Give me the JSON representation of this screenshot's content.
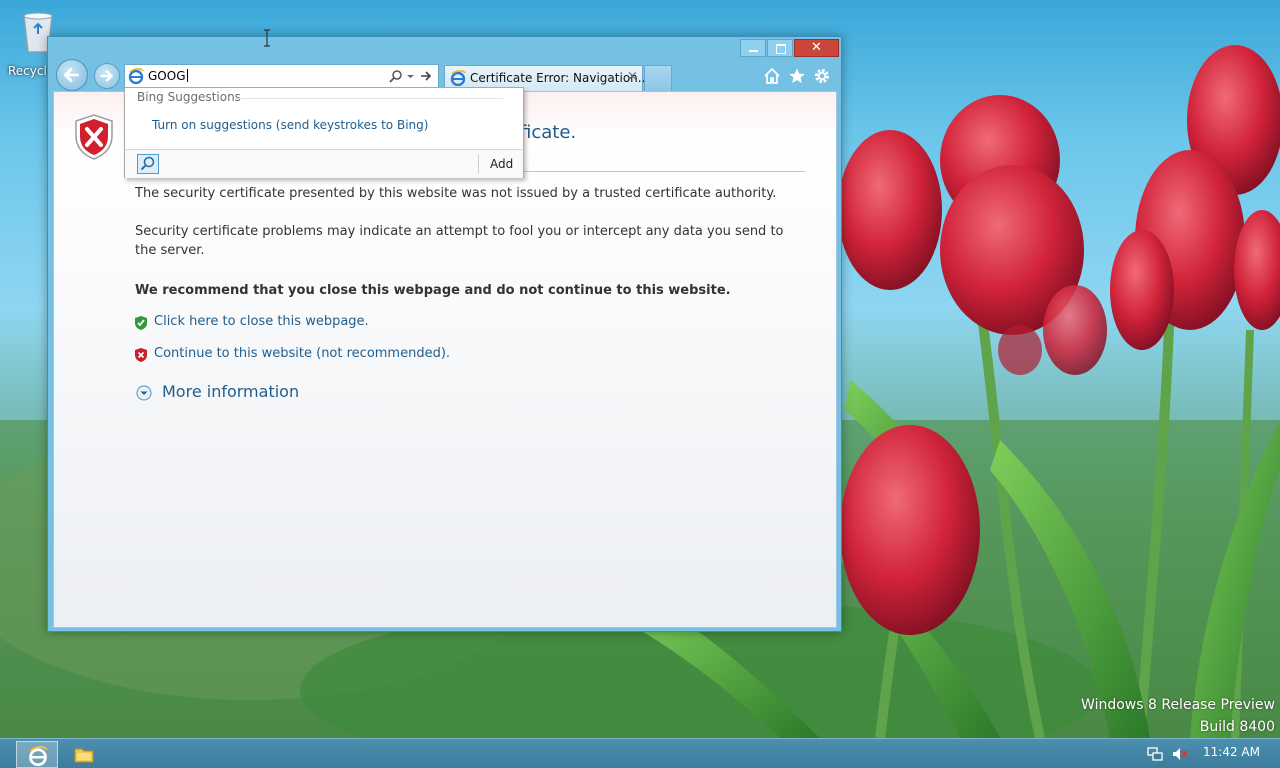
{
  "desktop": {
    "recycle_label": "Recycle",
    "watermark_line1": "Windows 8 Release Preview",
    "watermark_line2": "Build 8400"
  },
  "browser": {
    "address_text": "GOOG",
    "tab_title": "Certificate Error: Navigation...",
    "tab_close": "×",
    "close_glyph": "✕"
  },
  "page": {
    "title_visible": "ficate.",
    "para1": "The security certificate presented by this website was not issued by a trusted certificate authority.",
    "para2": "Security certificate problems may indicate an attempt to fool you or intercept any data you send to the server.",
    "recommend": "We recommend that you close this webpage and do not continue to this website.",
    "link_close": "Click here to close this webpage.",
    "link_continue": "Continue to this website (not recommended).",
    "more_info": "More information"
  },
  "suggestions": {
    "header": "Bing Suggestions",
    "turn_on": "Turn on suggestions (send keystrokes to Bing)",
    "add_label": "Add"
  },
  "taskbar": {
    "clock": "11:42 AM"
  },
  "colors": {
    "link": "#1f5e8f",
    "title": "#1c5a88",
    "close_button": "#c9473a",
    "window_frame": "#74c1e4",
    "taskbar": "#4c8faf"
  }
}
